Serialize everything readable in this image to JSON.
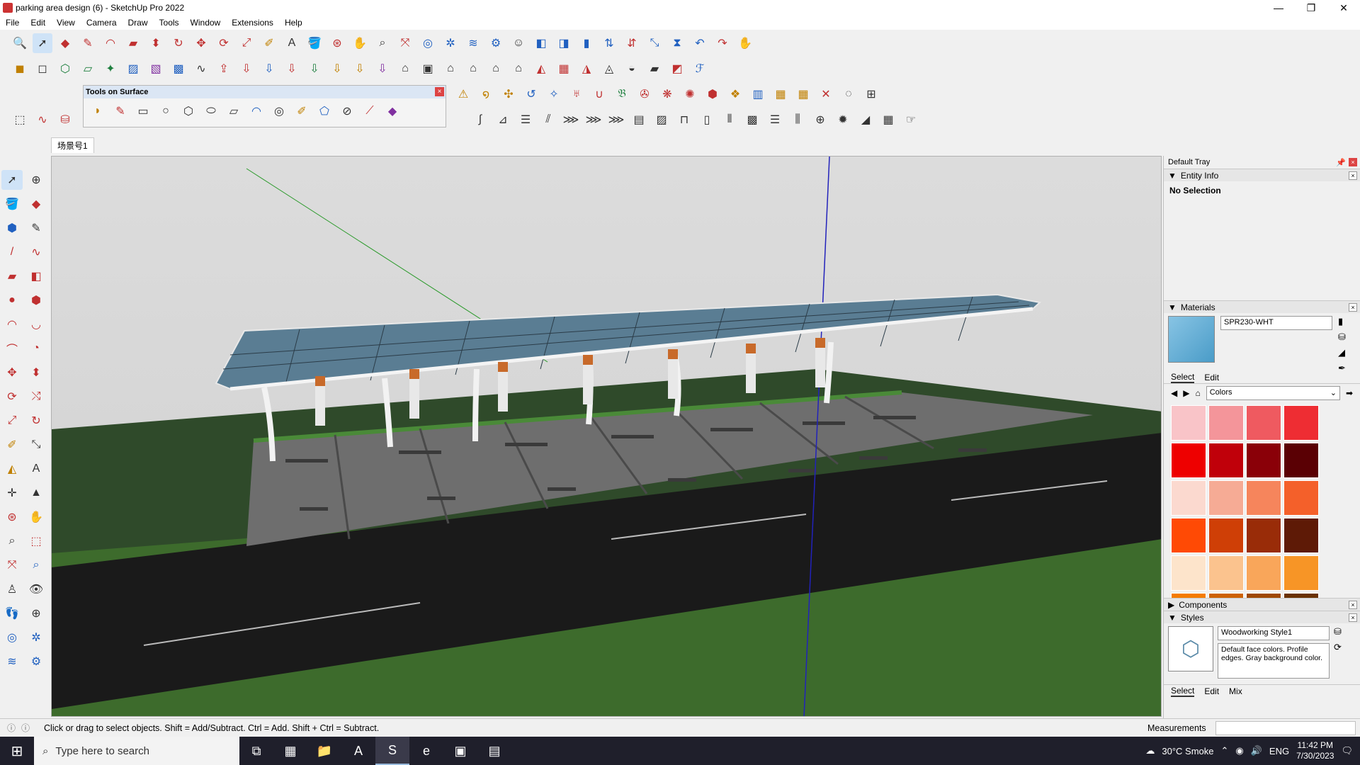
{
  "window": {
    "title": "parking area design (6) - SketchUp Pro 2022",
    "controls": [
      "—",
      "❐",
      "✕"
    ]
  },
  "menu": [
    "File",
    "Edit",
    "View",
    "Camera",
    "Draw",
    "Tools",
    "Window",
    "Extensions",
    "Help"
  ],
  "floating_toolbar": {
    "title": "Tools on Surface"
  },
  "scene_tab": "场景号1",
  "tray": {
    "title": "Default Tray",
    "entity_info": {
      "header": "Entity Info",
      "status": "No Selection"
    },
    "materials": {
      "header": "Materials",
      "name": "SPR230-WHT",
      "tabs": [
        "Select",
        "Edit"
      ],
      "library": "Colors",
      "swatches": [
        "#f9c4c8",
        "#f4959a",
        "#ef5a60",
        "#ee2d33",
        "#ee0000",
        "#c0000a",
        "#8a0008",
        "#5a0004",
        "#fbd9cf",
        "#f6ab95",
        "#f6855c",
        "#f4602a",
        "#ff4a05",
        "#cf3f06",
        "#992c08",
        "#5e1a06",
        "#fde4cb",
        "#fbc38e",
        "#f9a65a",
        "#f79526",
        "#f47c00",
        "#cd6200",
        "#9f4900",
        "#6a3100"
      ]
    },
    "components": {
      "header": "Components"
    },
    "styles": {
      "header": "Styles",
      "name": "Woodworking Style1",
      "description": "Default face colors. Profile edges. Gray background color.",
      "tabs": [
        "Select",
        "Edit",
        "Mix"
      ]
    }
  },
  "status": {
    "hint": "Click or drag to select objects. Shift = Add/Subtract. Ctrl = Add. Shift + Ctrl = Subtract.",
    "measurements_label": "Measurements"
  },
  "taskbar": {
    "search_placeholder": "Type here to search",
    "weather": "30°C Smoke",
    "language": "ENG",
    "time": "11:42 PM",
    "date": "7/30/2023"
  }
}
